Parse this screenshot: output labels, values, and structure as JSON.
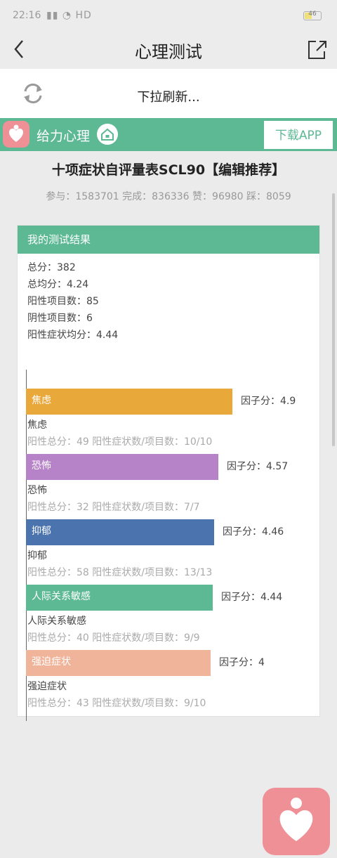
{
  "status_bar": {
    "time": "22:16",
    "signal": "HD",
    "battery": "46"
  },
  "nav": {
    "title": "心理测试"
  },
  "refresh": {
    "text": "下拉刷新..."
  },
  "brand": {
    "name": "给力心理",
    "download_label": "下载APP"
  },
  "test": {
    "title": "十项症状自评量表SCL90【编辑推荐】",
    "stats": "参与：1583701 完成：836336 赞：96980 踩：8059"
  },
  "result": {
    "header": "我的测试结果",
    "summary": [
      "总分：382",
      "总均分：4.24",
      "阳性项目数：85",
      "阴性项目数：6",
      "阳性症状均分：4.44"
    ]
  },
  "chart_data": {
    "type": "bar",
    "categories": [
      "焦虑",
      "恐怖",
      "抑郁",
      "人际关系敏感",
      "强迫症状"
    ],
    "values": [
      4.9,
      4.57,
      4.46,
      4.44,
      4.39
    ],
    "colors": [
      "#e9a83a",
      "#b783c8",
      "#4b73ae",
      "#5cb994",
      "#f0b49a"
    ],
    "score_labels": [
      "因子分：4.9",
      "因子分：4.57",
      "因子分：4.46",
      "因子分：4.44",
      "因子分：4"
    ],
    "details": [
      "阳性总分：49   阳性症状数/项目数：10/10",
      "阳性总分：32   阳性症状数/项目数：7/7",
      "阳性总分：58   阳性症状数/项目数：13/13",
      "阳性总分：40   阳性症状数/项目数：9/9",
      "阳性总分：43   阳性症状数/项目数：9/10"
    ],
    "xlim": [
      0,
      5.5
    ]
  }
}
